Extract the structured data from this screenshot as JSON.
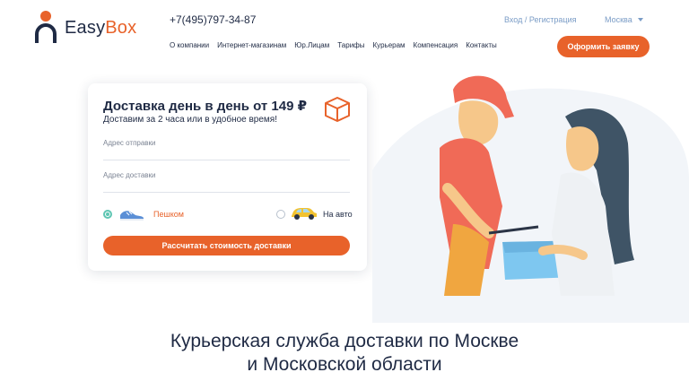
{
  "header": {
    "logo": {
      "word1": "Easy",
      "word2": "Box"
    },
    "phone": "+7(495)797-34-87",
    "login": "Вход / Регистрация",
    "city": "Москва",
    "order_button": "Оформить заявку",
    "nav": [
      "О компании",
      "Интернет-магазинам",
      "Юр.Лицам",
      "Тарифы",
      "Курьерам",
      "Компенсация",
      "Контакты"
    ]
  },
  "calculator": {
    "title": "Доставка день в день от 149 ₽",
    "subtitle": "Доставим за 2 часа или в удобное время!",
    "from_placeholder": "Адрес отправки",
    "to_placeholder": "Адрес доставки",
    "options": [
      {
        "label": "Пешком",
        "selected": true,
        "icon": "sneaker-icon"
      },
      {
        "label": "На авто",
        "selected": false,
        "icon": "car-icon"
      }
    ],
    "submit": "Рассчитать стоимость доставки"
  },
  "headline": {
    "line1": "Курьерская служба доставки по Москве",
    "line2": "и Московской области"
  },
  "colors": {
    "accent": "#e8622a",
    "dark": "#1f2a44",
    "link": "#7a9cc6",
    "radio": "#5fc6b3"
  }
}
